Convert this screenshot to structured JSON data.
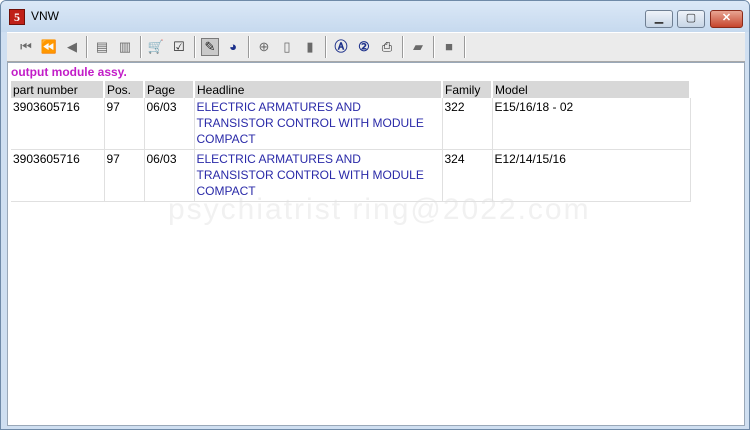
{
  "window": {
    "title": "VNW",
    "icon": "app-logo-icon"
  },
  "toolbar": {
    "buttons": [
      {
        "name": "first-icon",
        "glyph": "⏮"
      },
      {
        "name": "rewind-icon",
        "glyph": "⏪"
      },
      {
        "name": "previous-icon",
        "glyph": "◀"
      },
      {
        "name": "doc-back-icon",
        "glyph": "▤"
      },
      {
        "name": "doc-forward-icon",
        "glyph": "▥"
      },
      {
        "name": "cart-icon",
        "glyph": "🛒"
      },
      {
        "name": "checklist-icon",
        "glyph": "☑"
      },
      {
        "name": "pencil-icon",
        "glyph": "✎"
      },
      {
        "name": "globe-icon",
        "glyph": "◕"
      },
      {
        "name": "zoom-icon",
        "glyph": "⊕"
      },
      {
        "name": "page-icon",
        "glyph": "▯"
      },
      {
        "name": "page-alt-icon",
        "glyph": "▮"
      },
      {
        "name": "search-a-icon",
        "glyph": "Ⓐ"
      },
      {
        "name": "search-2-icon",
        "glyph": "②"
      },
      {
        "name": "print-icon",
        "glyph": "⎙"
      },
      {
        "name": "eraser-icon",
        "glyph": "▰"
      },
      {
        "name": "stop-icon",
        "glyph": "■"
      }
    ]
  },
  "content": {
    "section_title": "output module assy.",
    "columns": [
      "part number",
      "Pos.",
      "Page",
      "Headline",
      "Family",
      "Model"
    ],
    "rows": [
      {
        "part_number": "3903605716",
        "pos": "97",
        "page": "06/03",
        "headline": "ELECTRIC ARMATURES AND TRANSISTOR CONTROL WITH MODULE COMPACT",
        "family": "322",
        "model": "E15/16/18 - 02"
      },
      {
        "part_number": "3903605716",
        "pos": "97",
        "page": "06/03",
        "headline": "ELECTRIC ARMATURES AND TRANSISTOR CONTROL WITH MODULE COMPACT",
        "family": "324",
        "model": "E12/14/15/16"
      }
    ],
    "watermark": "psychiatrist ring@2022.com"
  },
  "colors": {
    "section_title": "#c21cc8",
    "headline_link": "#2a2aa8",
    "header_bg": "#d8d8d8"
  }
}
